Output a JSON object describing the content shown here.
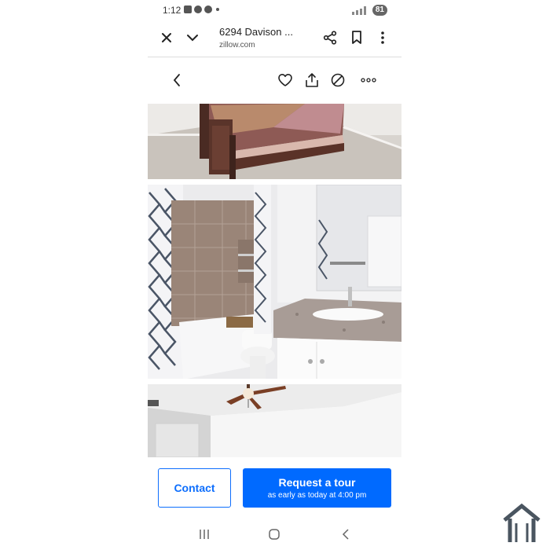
{
  "status": {
    "time": "1:12",
    "battery": "81"
  },
  "browser": {
    "title": "6294 Davison ...",
    "url": "zillow.com"
  },
  "icons": {
    "close": "close-icon",
    "chevron": "chevron-down-icon",
    "share": "share-icon",
    "bookmark": "bookmark-icon",
    "menu": "more-vertical-icon",
    "back": "back-icon",
    "heart": "heart-icon",
    "upload": "upload-share-icon",
    "hide": "hide-icon",
    "more": "more-horizontal-icon"
  },
  "photos": [
    {
      "label": "bedroom-photo"
    },
    {
      "label": "bathroom-photo"
    },
    {
      "label": "room-with-ceiling-fan-photo"
    }
  ],
  "cta": {
    "contact": "Contact",
    "tour_title": "Request a tour",
    "tour_sub": "as early as today at 4:00 pm"
  },
  "colors": {
    "accent": "#006aff",
    "contact_border": "#0d6efd"
  }
}
